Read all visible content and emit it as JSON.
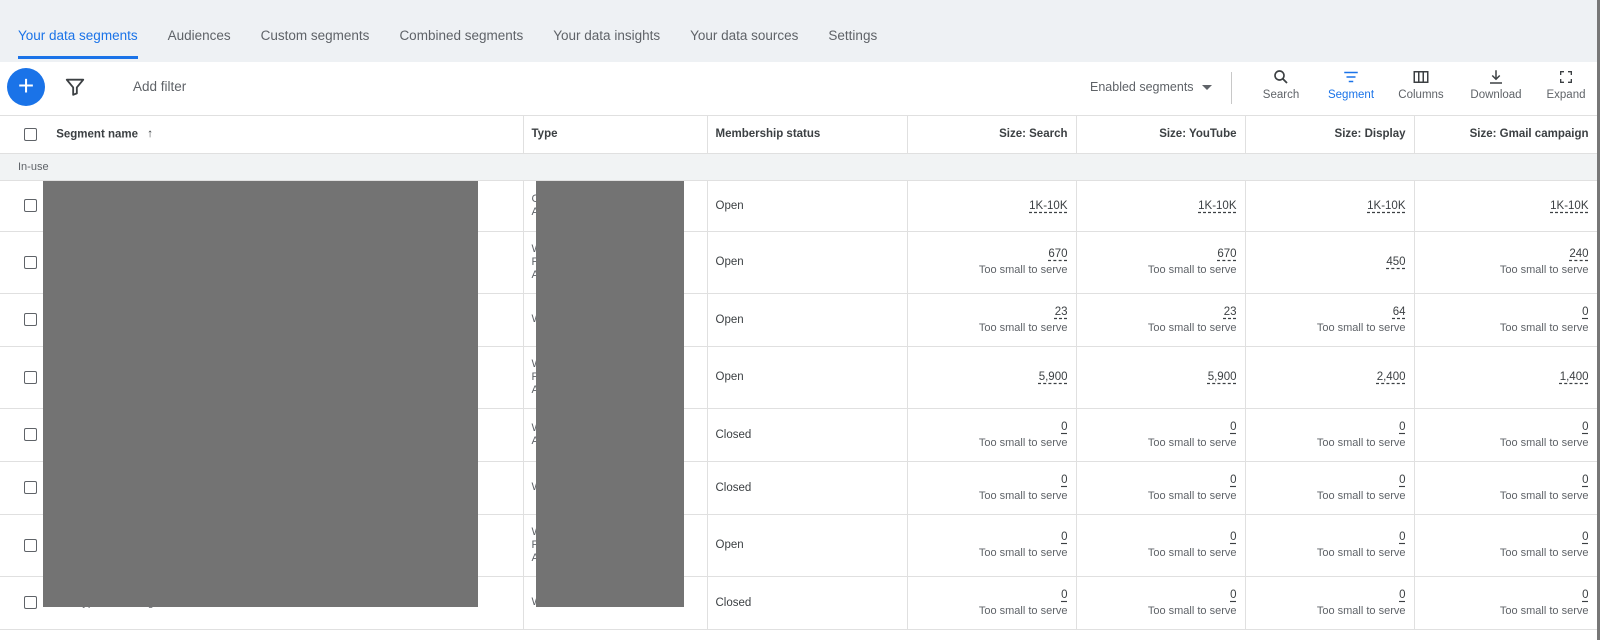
{
  "tabs": [
    {
      "label": "Your data segments",
      "active": true
    },
    {
      "label": "Audiences"
    },
    {
      "label": "Custom segments"
    },
    {
      "label": "Combined segments"
    },
    {
      "label": "Your data insights"
    },
    {
      "label": "Your data sources"
    },
    {
      "label": "Settings"
    }
  ],
  "toolbar": {
    "add_filter": "Add filter",
    "segment_filter": "Enabled segments",
    "tools": [
      {
        "label": "Search",
        "icon": "search-icon"
      },
      {
        "label": "Segment",
        "icon": "segment-icon",
        "active": true
      },
      {
        "label": "Columns",
        "icon": "columns-icon"
      },
      {
        "label": "Download",
        "icon": "download-icon"
      },
      {
        "label": "Expand",
        "icon": "expand-icon"
      }
    ]
  },
  "table": {
    "headers": {
      "name": "Segment name",
      "type": "Type",
      "membership": "Membership status",
      "search": "Size: Search",
      "youtube": "Size: YouTube",
      "display": "Size: Display",
      "gmail": "Size: Gmail campaign"
    },
    "group_label": "In-use",
    "rows": [
      {
        "name": "",
        "type": "C\nA",
        "membership": "Open",
        "search": {
          "v": "1K-10K",
          "s": ""
        },
        "youtube": {
          "v": "1K-10K",
          "s": ""
        },
        "display": {
          "v": "1K-10K",
          "s": ""
        },
        "gmail": {
          "v": "1K-10K",
          "s": ""
        }
      },
      {
        "name": "",
        "type": "W\nF\nA",
        "membership": "Open",
        "search": {
          "v": "670",
          "s": "Too small to serve"
        },
        "youtube": {
          "v": "670",
          "s": "Too small to serve"
        },
        "display": {
          "v": "450",
          "s": ""
        },
        "gmail": {
          "v": "240",
          "s": "Too small to serve"
        }
      },
      {
        "name": "",
        "type": "W",
        "membership": "Open",
        "search": {
          "v": "23",
          "s": "Too small to serve"
        },
        "youtube": {
          "v": "23",
          "s": "Too small to serve"
        },
        "display": {
          "v": "64",
          "s": "Too small to serve"
        },
        "gmail": {
          "v": "0",
          "s": "Too small to serve"
        }
      },
      {
        "name": "",
        "type": "W\nF\nA",
        "membership": "Open",
        "search": {
          "v": "5,900",
          "s": ""
        },
        "youtube": {
          "v": "5,900",
          "s": ""
        },
        "display": {
          "v": "2,400",
          "s": ""
        },
        "gmail": {
          "v": "1,400",
          "s": ""
        }
      },
      {
        "name": "",
        "type": "W\nA",
        "membership": "Closed",
        "search": {
          "v": "0",
          "s": "Too small to serve"
        },
        "youtube": {
          "v": "0",
          "s": "Too small to serve"
        },
        "display": {
          "v": "0",
          "s": "Too small to serve"
        },
        "gmail": {
          "v": "0",
          "s": "Too small to serve"
        }
      },
      {
        "name": "",
        "type": "W",
        "membership": "Closed",
        "search": {
          "v": "0",
          "s": "Too small to serve"
        },
        "youtube": {
          "v": "0",
          "s": "Too small to serve"
        },
        "display": {
          "v": "0",
          "s": "Too small to serve"
        },
        "gmail": {
          "v": "0",
          "s": "Too small to serve"
        }
      },
      {
        "name": "",
        "type": "W\nF\nA",
        "membership": "Open",
        "search": {
          "v": "0",
          "s": "Too small to serve"
        },
        "youtube": {
          "v": "0",
          "s": "Too small to serve"
        },
        "display": {
          "v": "0",
          "s": "Too small to serve"
        },
        "gmail": {
          "v": "0",
          "s": "Too small to serve"
        }
      },
      {
        "name": "User type: Returning visitor",
        "type": "W",
        "membership": "Closed",
        "search": {
          "v": "0",
          "s": "Too small to serve"
        },
        "youtube": {
          "v": "0",
          "s": "Too small to serve"
        },
        "display": {
          "v": "0",
          "s": "Too small to serve"
        },
        "gmail": {
          "v": "0",
          "s": "Too small to serve"
        }
      }
    ]
  },
  "colors": {
    "accent": "#1a73e8",
    "redaction": "#737373"
  }
}
